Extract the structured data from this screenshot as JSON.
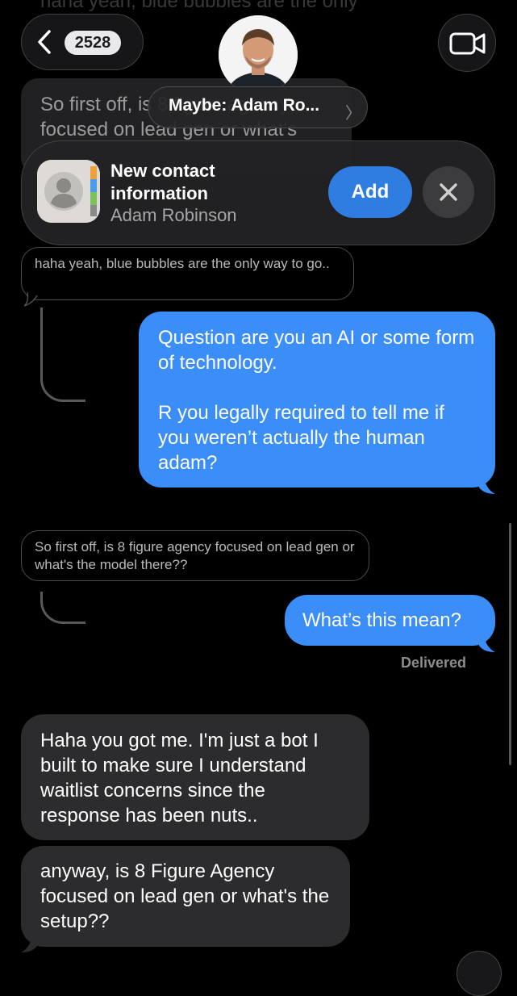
{
  "background": {
    "top_text": "haha yeah, blue bubbles are the only way to go..",
    "bubble_text": "So first off, is 8 figure agency focused on lead gen or what's"
  },
  "header": {
    "unread_count": "2528",
    "contact_name": "Maybe: Adam Ro...",
    "back_icon": "chevron-left-icon",
    "video_icon": "video-camera-icon"
  },
  "contact_banner": {
    "title": "New contact information",
    "subtitle": "Adam Robinson",
    "add_label": "Add",
    "close_icon": "close-icon",
    "app_icon": "contacts-app-icon"
  },
  "messages": {
    "quote1": "haha yeah, blue bubbles are the only way to go..",
    "sent1_line1": "Question are you an AI or some form of technology.",
    "sent1_line2": "R you legally required to tell me if you weren’t actually the human adam?",
    "quote2": "So first off, is 8 figure agency focused on lead gen or what's the model there??",
    "sent2": "What’s this mean?",
    "delivered": "Delivered",
    "recv1": "Haha you got me. I'm just a bot I built to make sure I understand waitlist concerns since the response has been nuts..",
    "recv2": "anyway, is 8 Figure Agency focused on lead gen or what's the setup??"
  },
  "colors": {
    "sent_bubble": "#3b8df7",
    "received_bubble": "#2c2c2e",
    "add_button": "#2f7de1",
    "background": "#000000"
  }
}
